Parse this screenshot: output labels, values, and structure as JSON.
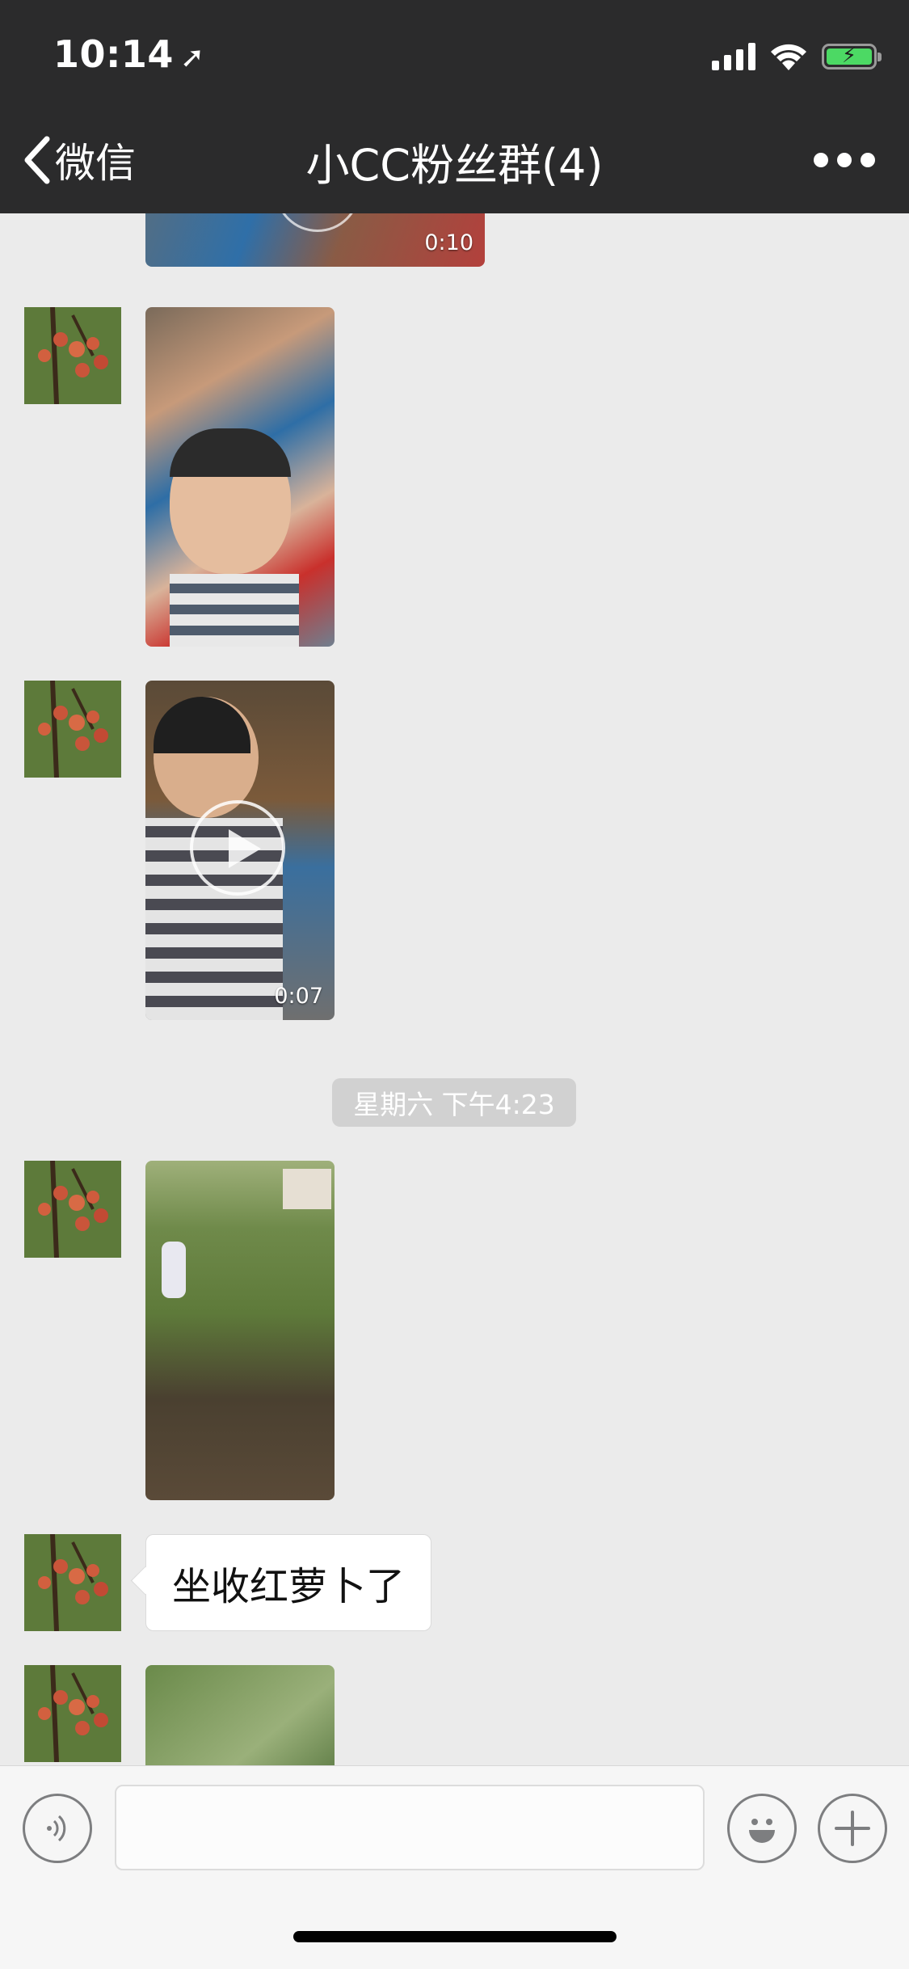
{
  "status": {
    "time": "10:14"
  },
  "nav": {
    "back_label": "微信",
    "title": "小CC粉丝群(4)"
  },
  "messages": [
    {
      "type": "video",
      "duration": "0:10"
    },
    {
      "type": "image"
    },
    {
      "type": "video",
      "duration": "0:07"
    },
    {
      "type": "timestamp",
      "text": "星期六 下午4:23"
    },
    {
      "type": "image"
    },
    {
      "type": "text",
      "text": "坐收红萝卜了"
    },
    {
      "type": "image"
    }
  ],
  "input": {
    "value": ""
  },
  "colors": {
    "header_bg": "#2b2b2c",
    "chat_bg": "#ebebeb",
    "battery_green": "#4cd964",
    "timestamp_pill": "#d1d1d1"
  }
}
